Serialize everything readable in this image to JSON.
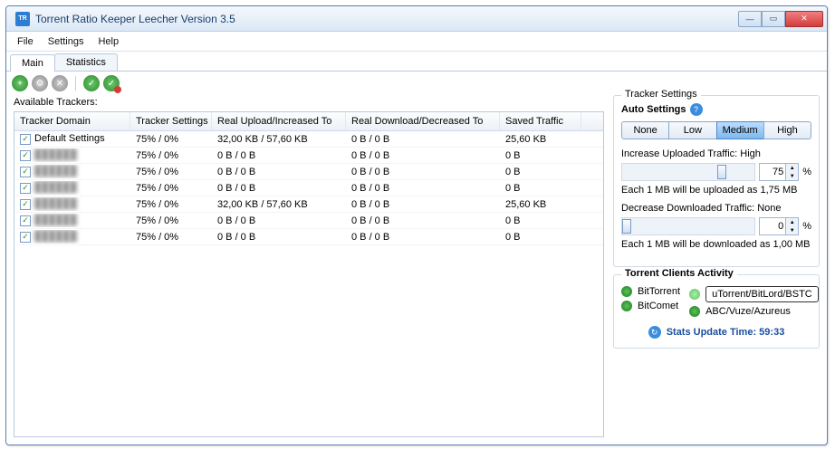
{
  "window": {
    "title": "Torrent Ratio Keeper Leecher Version  3.5"
  },
  "menu": {
    "file": "File",
    "settings": "Settings",
    "help": "Help"
  },
  "tabs": {
    "main": "Main",
    "stats": "Statistics"
  },
  "trackers": {
    "label": "Available Trackers:",
    "columns": [
      "Tracker Domain",
      "Tracker Settings",
      "Real Upload/Increased To",
      "Real Download/Decreased To",
      "Saved Traffic"
    ],
    "rows": [
      {
        "checked": true,
        "domain": "Default Settings",
        "settings": "75% / 0%",
        "upload": "32,00 KB / 57,60 KB",
        "download": "0 B / 0 B",
        "saved": "25,60 KB",
        "blur": false
      },
      {
        "checked": true,
        "domain": "██████",
        "settings": "75% / 0%",
        "upload": "0 B / 0 B",
        "download": "0 B / 0 B",
        "saved": "0 B",
        "blur": true
      },
      {
        "checked": true,
        "domain": "██████",
        "settings": "75% / 0%",
        "upload": "0 B / 0 B",
        "download": "0 B / 0 B",
        "saved": "0 B",
        "blur": true
      },
      {
        "checked": true,
        "domain": "██████",
        "settings": "75% / 0%",
        "upload": "0 B / 0 B",
        "download": "0 B / 0 B",
        "saved": "0 B",
        "blur": true
      },
      {
        "checked": true,
        "domain": "██████",
        "settings": "75% / 0%",
        "upload": "32,00 KB / 57,60 KB",
        "download": "0 B / 0 B",
        "saved": "25,60 KB",
        "blur": true
      },
      {
        "checked": true,
        "domain": "██████",
        "settings": "75% / 0%",
        "upload": "0 B / 0 B",
        "download": "0 B / 0 B",
        "saved": "0 B",
        "blur": true
      },
      {
        "checked": true,
        "domain": "██████",
        "settings": "75% / 0%",
        "upload": "0 B / 0 B",
        "download": "0 B / 0 B",
        "saved": "0 B",
        "blur": true
      }
    ]
  },
  "settings": {
    "legend": "Tracker Settings",
    "auto_label": "Auto Settings",
    "levels": {
      "none": "None",
      "low": "Low",
      "medium": "Medium",
      "high": "High"
    },
    "active_level": "medium",
    "upload_label": "Increase Uploaded Traffic: High",
    "upload_value": "75",
    "upload_percent": "%",
    "upload_note": "Each 1 MB will be uploaded as 1,75 MB",
    "download_label": "Decrease Downloaded Traffic: None",
    "download_value": "0",
    "download_percent": "%",
    "download_note": "Each 1 MB will be downloaded as 1,00 MB"
  },
  "clients": {
    "legend": "Torrent Clients Activity",
    "c1": "BitTorrent",
    "c2": "uTorrent/BitLord/BSTC",
    "c3": "BitComet",
    "c4": "ABC/Vuze/Azureus",
    "stats": "Stats Update Time: 59:33"
  }
}
